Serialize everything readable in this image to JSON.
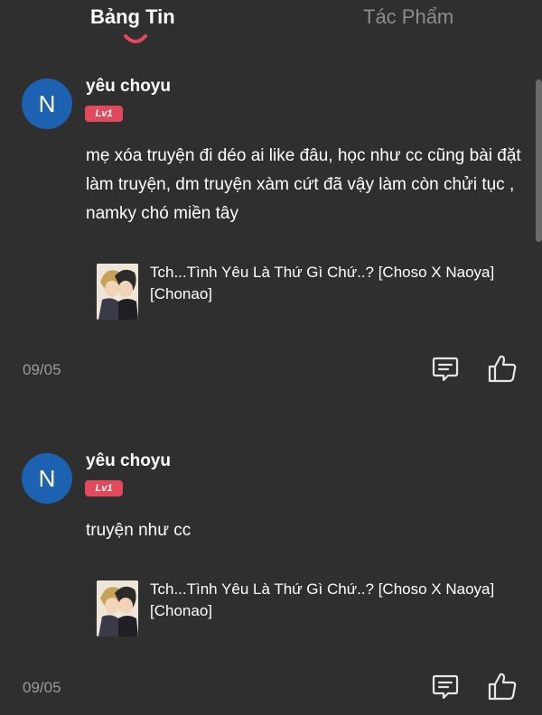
{
  "tabs": [
    {
      "label": "Bảng Tin",
      "active": true
    },
    {
      "label": "Tác Phẩm",
      "active": false
    }
  ],
  "accent_color": "#e14a5c",
  "posts": [
    {
      "avatar_letter": "N",
      "username": "yêu choyu",
      "level": "Lv1",
      "content": "mẹ xóa truyện đi déo ai like đâu, học như cc cũng bài đặt làm truyện, dm truyện xàm cứt đã vậy làm còn chửi tục , namky chó miền tây",
      "story_title": "Tch...Tình Yêu Là Thứ Gì Chứ..? [Choso X Naoya] [Chonao]",
      "date": "09/05",
      "icons": [
        "comment-icon",
        "like-icon"
      ]
    },
    {
      "avatar_letter": "N",
      "username": "yêu choyu",
      "level": "Lv1",
      "content": "truyện như cc",
      "story_title": "Tch...Tình Yêu Là Thứ Gì Chứ..? [Choso X Naoya] [Chonao]",
      "date": "09/05",
      "icons": [
        "comment-icon",
        "like-icon"
      ]
    }
  ]
}
